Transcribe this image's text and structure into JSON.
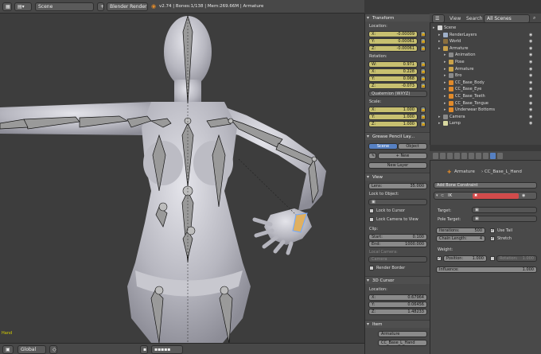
{
  "topbar": {
    "scene": "Scene",
    "engine": "Blender Render",
    "version": "v2.74",
    "bones": "Bones:1/138",
    "mem": "Mem:269.66M",
    "object": "Armature"
  },
  "viewport": {
    "object_label": "Hand"
  },
  "bottombar": {
    "orientation": "Global"
  },
  "npanel": {
    "transform": "Transform",
    "location": "Location:",
    "loc": [
      {
        "k": "X:",
        "v": "-0.00009"
      },
      {
        "k": "Y:",
        "v": "0.00061"
      },
      {
        "k": "Z:",
        "v": "-0.00061"
      }
    ],
    "rotation": "Rotation:",
    "rot": [
      {
        "k": "W:",
        "v": "0.971"
      },
      {
        "k": "X:",
        "v": "0.228"
      },
      {
        "k": "Y:",
        "v": "0.068"
      },
      {
        "k": "Z:",
        "v": "-0.073"
      }
    ],
    "rotmode": "Quaternion (WXYZ)",
    "scale": "Scale:",
    "scl": [
      {
        "k": "X:",
        "v": "1.000"
      },
      {
        "k": "Y:",
        "v": "1.000"
      },
      {
        "k": "Z:",
        "v": "1.000"
      }
    ],
    "gpencil": "Grease Pencil Lay...",
    "gp_scene": "Scene",
    "gp_object": "Object",
    "gp_new": "New",
    "gp_newlayer": "New Layer",
    "view": "View",
    "lens_k": "Lens:",
    "lens_v": "35.000",
    "lockobj": "Lock to Object:",
    "lockcursor": "Lock to Cursor",
    "lockcamera": "Lock Camera to View",
    "clip": "Clip:",
    "start_k": "Start:",
    "start_v": "0.100",
    "end_k": "End:",
    "end_v": "1000.000",
    "localcam": "Local Camera:",
    "camera": "Camera",
    "renderborder": "Render Border",
    "cursor3d": "3D Cursor",
    "cloc": "Location:",
    "cur": [
      {
        "k": "X:",
        "v": "0.67964"
      },
      {
        "k": "Y:",
        "v": "0.06456"
      },
      {
        "k": "Z:",
        "v": "1.48233"
      }
    ],
    "item": "Item",
    "item_armature": "Armature",
    "item_bone": "CC_Base_L_Hand"
  },
  "outliner": {
    "view": "View",
    "search": "Search",
    "filter": "All Scenes",
    "rows": [
      {
        "t": "Scene",
        "d": 0,
        "c": "#d6d6d6"
      },
      {
        "t": "RenderLayers",
        "d": 1,
        "c": "#9fb0c8"
      },
      {
        "t": "World",
        "d": 1,
        "c": "#8a6f3e"
      },
      {
        "t": "Armature",
        "d": 1,
        "c": "#c9a24a"
      },
      {
        "t": "Animation",
        "d": 2,
        "c": "#8a8a8a"
      },
      {
        "t": "Pose",
        "d": 2,
        "c": "#c9a24a"
      },
      {
        "t": "Armature",
        "d": 2,
        "c": "#c9a24a"
      },
      {
        "t": "Bro",
        "d": 2,
        "c": "#8a8a8a"
      },
      {
        "t": "CC_Base_Body",
        "d": 2,
        "c": "#e08a2a"
      },
      {
        "t": "CC_Base_Eye",
        "d": 2,
        "c": "#e08a2a"
      },
      {
        "t": "CC_Base_Teeth",
        "d": 2,
        "c": "#e08a2a"
      },
      {
        "t": "CC_Base_Tongue",
        "d": 2,
        "c": "#e08a2a"
      },
      {
        "t": "Underwear Bottoms",
        "d": 2,
        "c": "#e08a2a"
      },
      {
        "t": "Camera",
        "d": 1,
        "c": "#8a8a8a"
      },
      {
        "t": "Lamp",
        "d": 1,
        "c": "#d8d8a0"
      }
    ]
  },
  "props": {
    "bc_armature": "Armature",
    "bc_bone": "CC_Base_L_Hand",
    "addconstraint": "Add Bone Constraint",
    "ik": "IK",
    "target": "Target:",
    "poletarget": "Pole Target:",
    "iterations_k": "Iterations:",
    "iterations_v": "500",
    "chain_k": "Chain Length:",
    "chain_v": "4",
    "usetail": "Use Tail",
    "stretch": "Stretch",
    "weight": "Weight:",
    "position_k": "Position:",
    "position_v": "1.000",
    "rotation_k": "Rotation:",
    "rotation_v": "1.000",
    "influence_k": "Influence:",
    "influence_v": "1.000"
  },
  "colors": {
    "yellow_field": "#c8c070",
    "selected_blue": "#5680c2",
    "ik_red": "#d24b4b"
  }
}
